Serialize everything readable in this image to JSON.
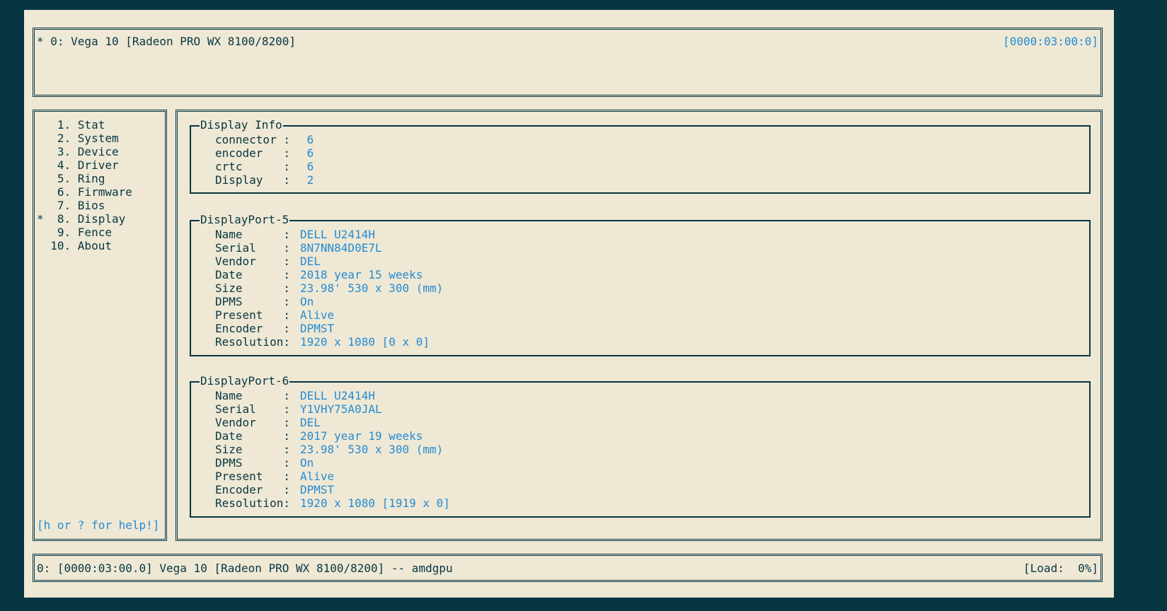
{
  "header": {
    "title": "* 0: Vega 10 [Radeon PRO WX 8100/8200]",
    "pci": "[0000:03:00:0]"
  },
  "menu": {
    "items": [
      {
        "text": "   1. Stat"
      },
      {
        "text": "   2. System"
      },
      {
        "text": "   3. Device"
      },
      {
        "text": "   4. Driver"
      },
      {
        "text": "   5. Ring"
      },
      {
        "text": "   6. Firmware"
      },
      {
        "text": "   7. Bios"
      },
      {
        "text": "*  8. Display"
      },
      {
        "text": "   9. Fence"
      },
      {
        "text": "  10. About"
      }
    ],
    "help": "[h or ? for help!]"
  },
  "display_info": {
    "title": "Display Info",
    "rows": [
      {
        "key": "connector :",
        "value": " 6"
      },
      {
        "key": "encoder   :",
        "value": " 6"
      },
      {
        "key": "crtc      :",
        "value": " 6"
      },
      {
        "key": "Display   :",
        "value": " 2"
      }
    ]
  },
  "dp5": {
    "title": "DisplayPort-5",
    "rows": [
      {
        "key": "Name      :",
        "value": "DELL U2414H"
      },
      {
        "key": "Serial    :",
        "value": "8N7NN84D0E7L"
      },
      {
        "key": "Vendor    :",
        "value": "DEL"
      },
      {
        "key": "Date      :",
        "value": "2018 year 15 weeks"
      },
      {
        "key": "Size      :",
        "value": "23.98' 530 x 300 (mm)"
      },
      {
        "key": "DPMS      :",
        "value": "On"
      },
      {
        "key": "Present   :",
        "value": "Alive"
      },
      {
        "key": "Encoder   :",
        "value": "DPMST"
      },
      {
        "key": "Resolution:",
        "value": "1920 x 1080 [0 x 0]"
      }
    ]
  },
  "dp6": {
    "title": "DisplayPort-6",
    "rows": [
      {
        "key": "Name      :",
        "value": "DELL U2414H"
      },
      {
        "key": "Serial    :",
        "value": "Y1VHY75A0JAL"
      },
      {
        "key": "Vendor    :",
        "value": "DEL"
      },
      {
        "key": "Date      :",
        "value": "2017 year 19 weeks"
      },
      {
        "key": "Size      :",
        "value": "23.98' 530 x 300 (mm)"
      },
      {
        "key": "DPMS      :",
        "value": "On"
      },
      {
        "key": "Present   :",
        "value": "Alive"
      },
      {
        "key": "Encoder   :",
        "value": "DPMST"
      },
      {
        "key": "Resolution:",
        "value": "1920 x 1080 [1919 x 0]"
      }
    ]
  },
  "footer": {
    "info": "0: [0000:03:00.0] Vega 10 [Radeon PRO WX 8100/8200] -- amdgpu",
    "load": "[Load:  0%]"
  }
}
